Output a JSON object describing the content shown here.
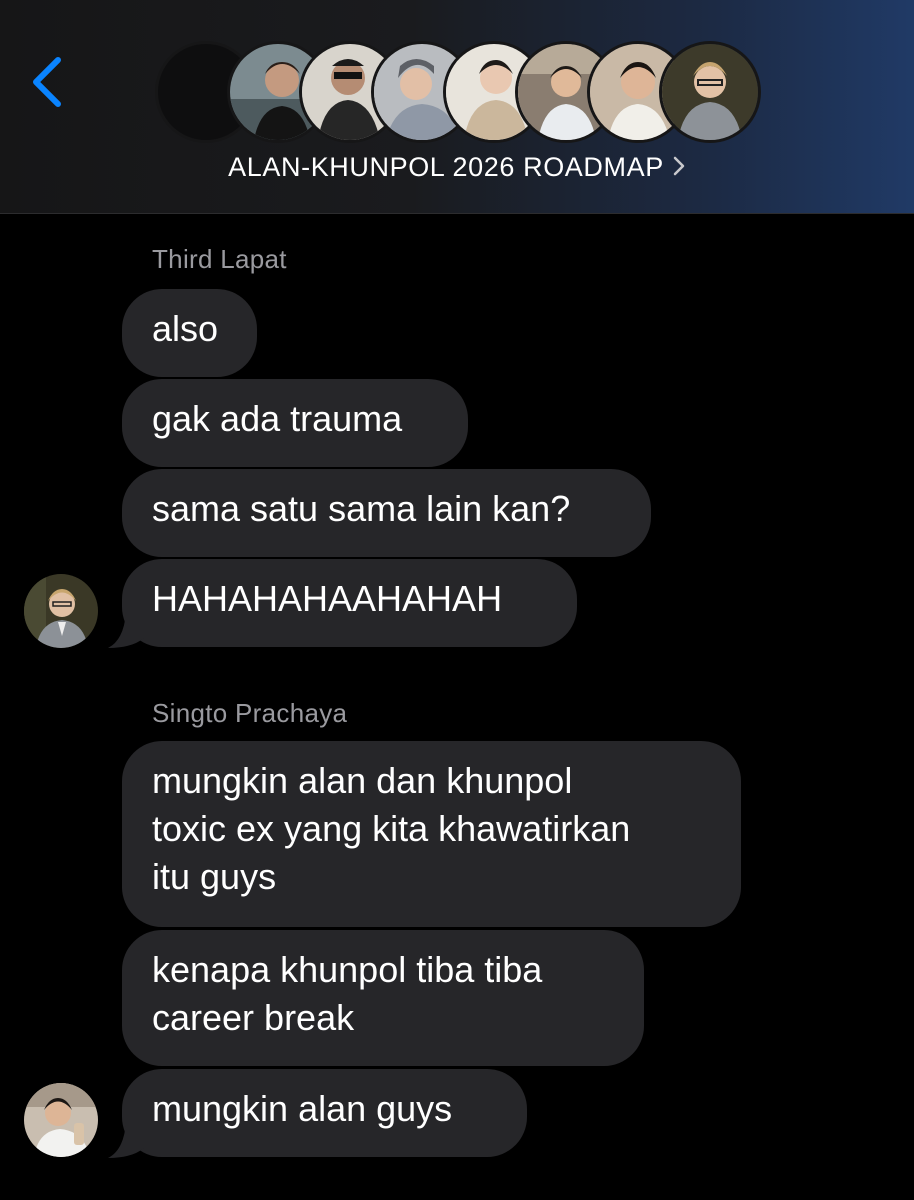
{
  "header": {
    "back_icon": "chevron-left-icon",
    "group_name": "ALAN-KHUNPOL 2026 ROADMAP",
    "group_chevron_icon": "chevron-right-icon",
    "participants_count": 8
  },
  "conversation": [
    {
      "sender": "Third Lapat",
      "messages": [
        "also",
        "gak ada trauma",
        "sama satu sama lain kan?",
        "HAHAHAHAAHAHAH"
      ]
    },
    {
      "sender": "Singto Prachaya",
      "messages": [
        "mungkin alan dan khunpol\ntoxic ex yang kita khawatirkan\nitu guys",
        "kenapa khunpol tiba tiba\ncareer break",
        "mungkin alan guys"
      ]
    }
  ],
  "colors": {
    "accent": "#0a84ff",
    "bubble": "#262629",
    "sender_text": "#9a9a9f",
    "background": "#000000"
  }
}
